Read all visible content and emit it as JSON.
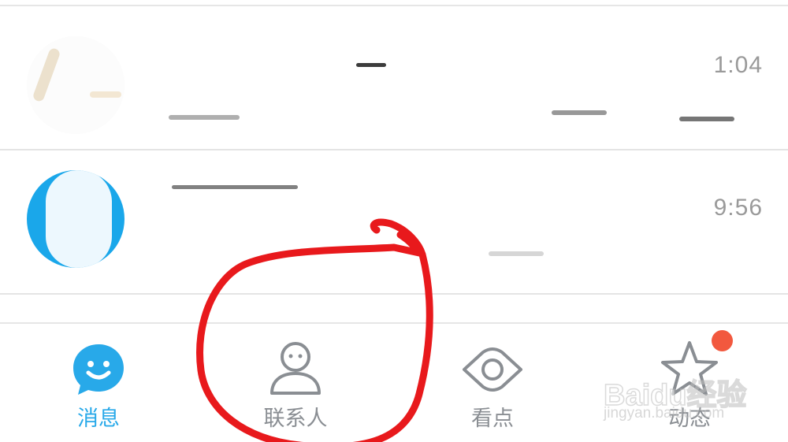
{
  "conversations": [
    {
      "time": "1:04"
    },
    {
      "time": "9:56"
    }
  ],
  "tabbar": {
    "tabs": [
      {
        "label": "消息",
        "icon": "message-smiley-icon",
        "active": true
      },
      {
        "label": "联系人",
        "icon": "contact-person-icon",
        "active": false
      },
      {
        "label": "看点",
        "icon": "eye-icon",
        "active": false
      },
      {
        "label": "动态",
        "icon": "star-icon",
        "active": false
      }
    ]
  },
  "watermark": {
    "brand": "Baidu经验",
    "url": "jingyan.baidu.com"
  },
  "colors": {
    "accent": "#28a9e9",
    "inactive": "#8a8e93",
    "badge": "#f2583e",
    "annotation": "#e8191c"
  }
}
